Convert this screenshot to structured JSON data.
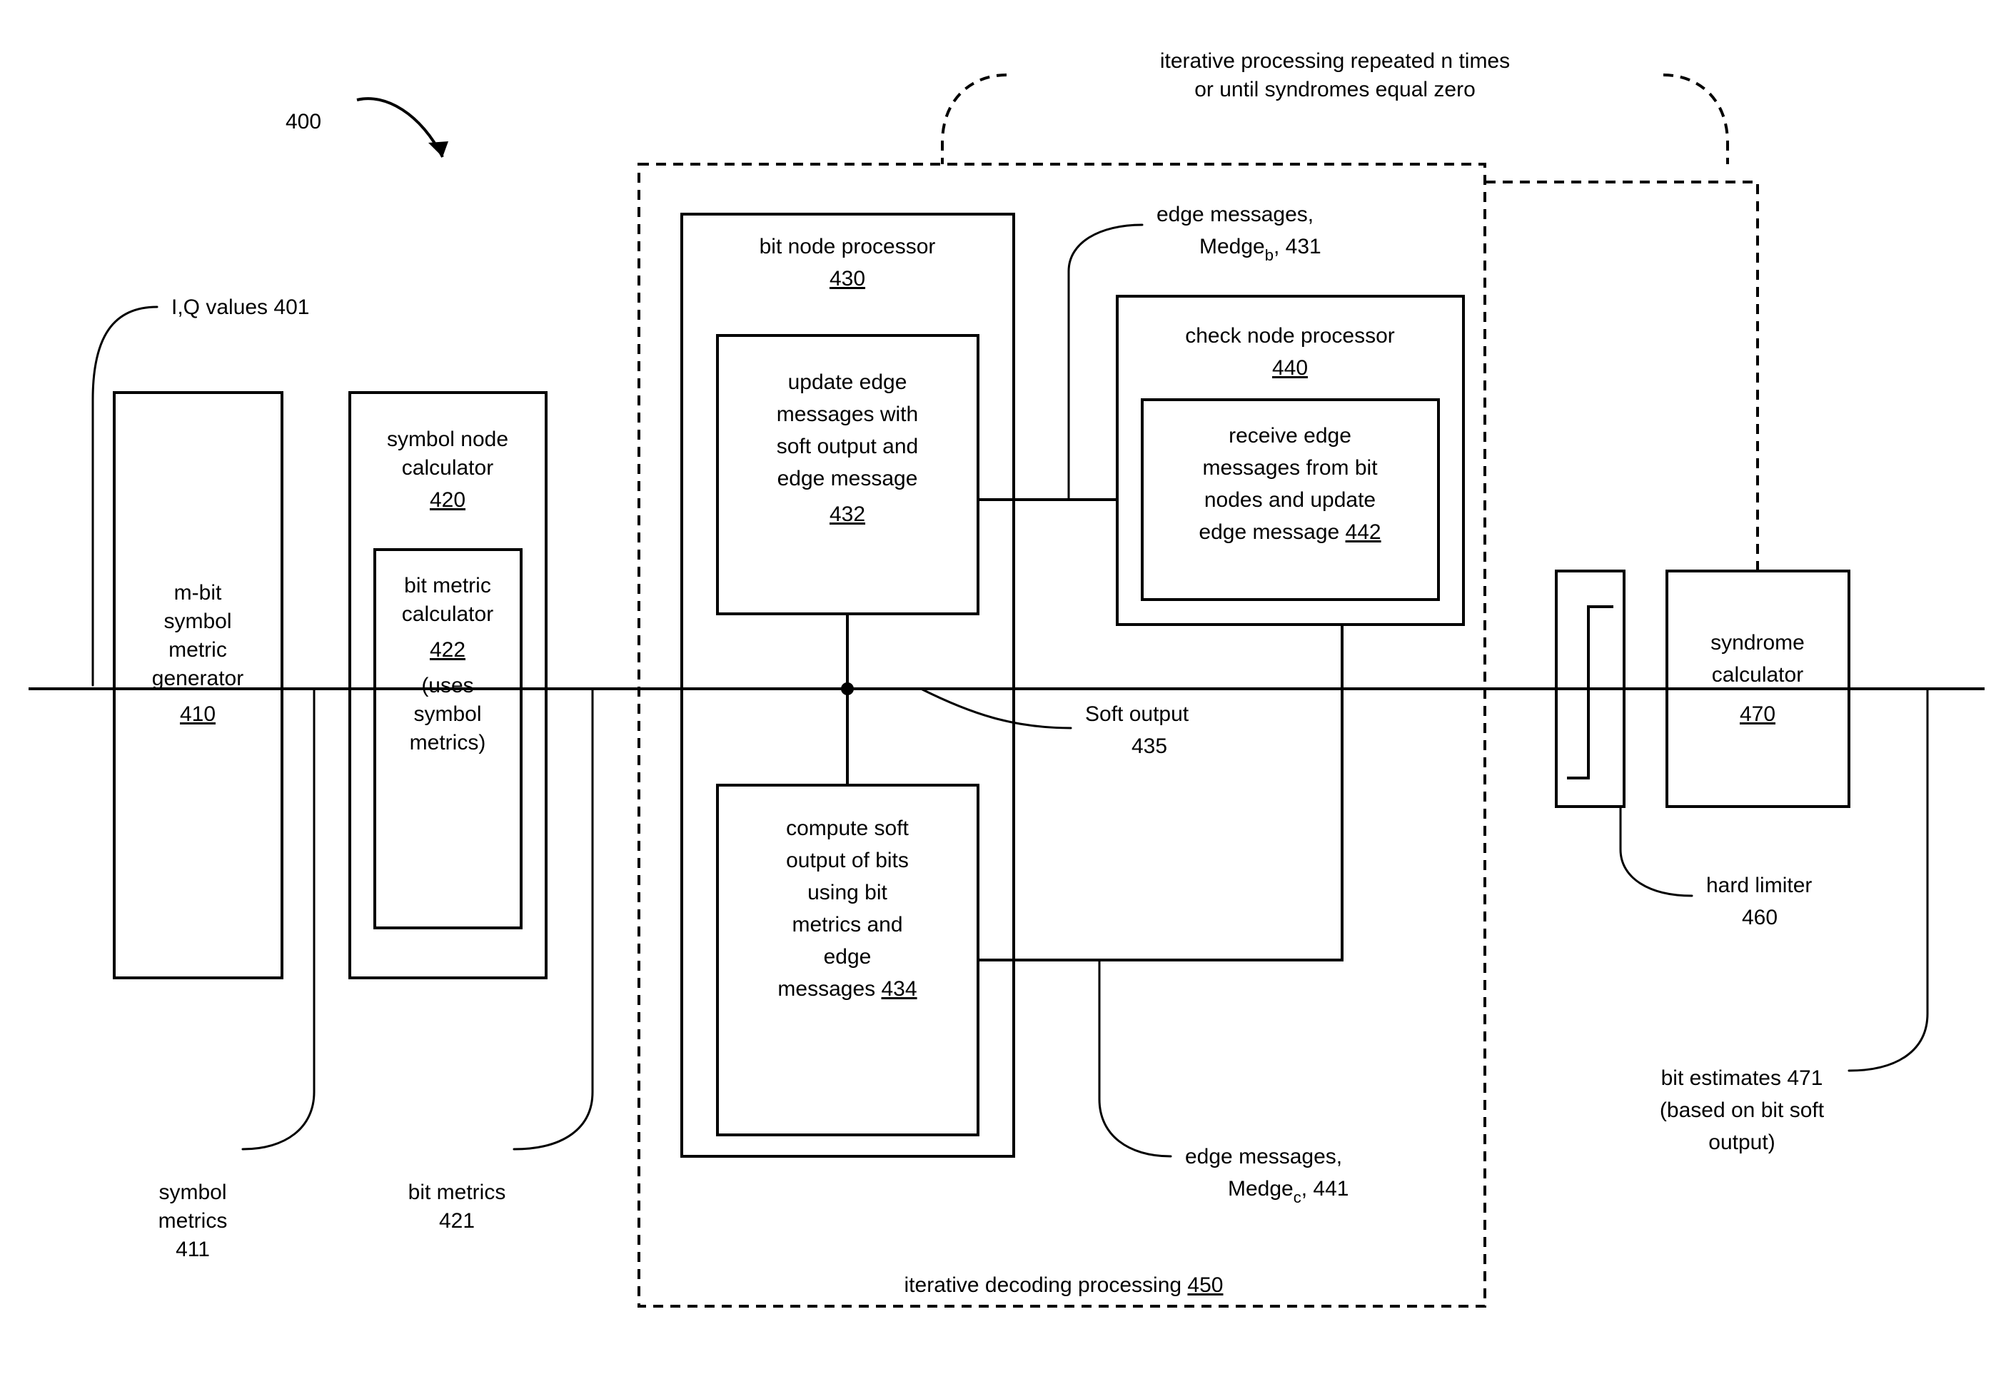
{
  "figNum": "400",
  "iqLabel": "I,Q values 401",
  "topNote1": "iterative processing repeated n times",
  "topNote2": "or until syndromes equal zero",
  "gen1": "m-bit",
  "gen2": "symbol",
  "gen3": "metric",
  "gen4": "generator",
  "genRef": "410",
  "symCalc1": "symbol node",
  "symCalc2": "calculator",
  "symCalcRef": "420",
  "bitCalc1": "bit metric",
  "bitCalc2": "calculator",
  "bitCalcRef": "422",
  "bitCalc3": "(uses",
  "bitCalc4": "symbol",
  "bitCalc5": "metrics)",
  "symMet1": "symbol",
  "symMet2": "metrics",
  "symMet3": "411",
  "bitMet1": "bit metrics",
  "bitMet2": "421",
  "bnp": "bit node processor",
  "bnpRef": "430",
  "upd1": "update edge",
  "upd2": "messages with",
  "upd3": "soft output and",
  "upd4": "edge message",
  "updRef": "432",
  "cmp1": "compute soft",
  "cmp2": "output of bits",
  "cmp3": "using bit",
  "cmp4": "metrics and",
  "cmp5": "edge",
  "cmp6a": "messages ",
  "cmp6b": "434",
  "cnp1": "check node processor",
  "cnpRef": "440",
  "rcv1": "receive edge",
  "rcv2": "messages from bit",
  "rcv3": "nodes and update",
  "rcv4a": "edge message ",
  "rcv4b": "442",
  "edgeB1": "edge messages,",
  "edgeB2a": "Medge",
  "edgeB2b": "b",
  "edgeB2c": ", 431",
  "soft1": "Soft output",
  "soft2": "435",
  "edgeC1": "edge messages,",
  "edgeC2a": "Medge",
  "edgeC2b": "c",
  "edgeC2c": ", 441",
  "iterLabelA": "iterative decoding processing ",
  "iterLabelB": "450",
  "synd1": "syndrome",
  "synd2": "calculator",
  "syndRef": "470",
  "hard1": "hard limiter",
  "hard2": "460",
  "bitEst1": "bit estimates 471",
  "bitEst2": "(based on bit soft",
  "bitEst3": "output)"
}
